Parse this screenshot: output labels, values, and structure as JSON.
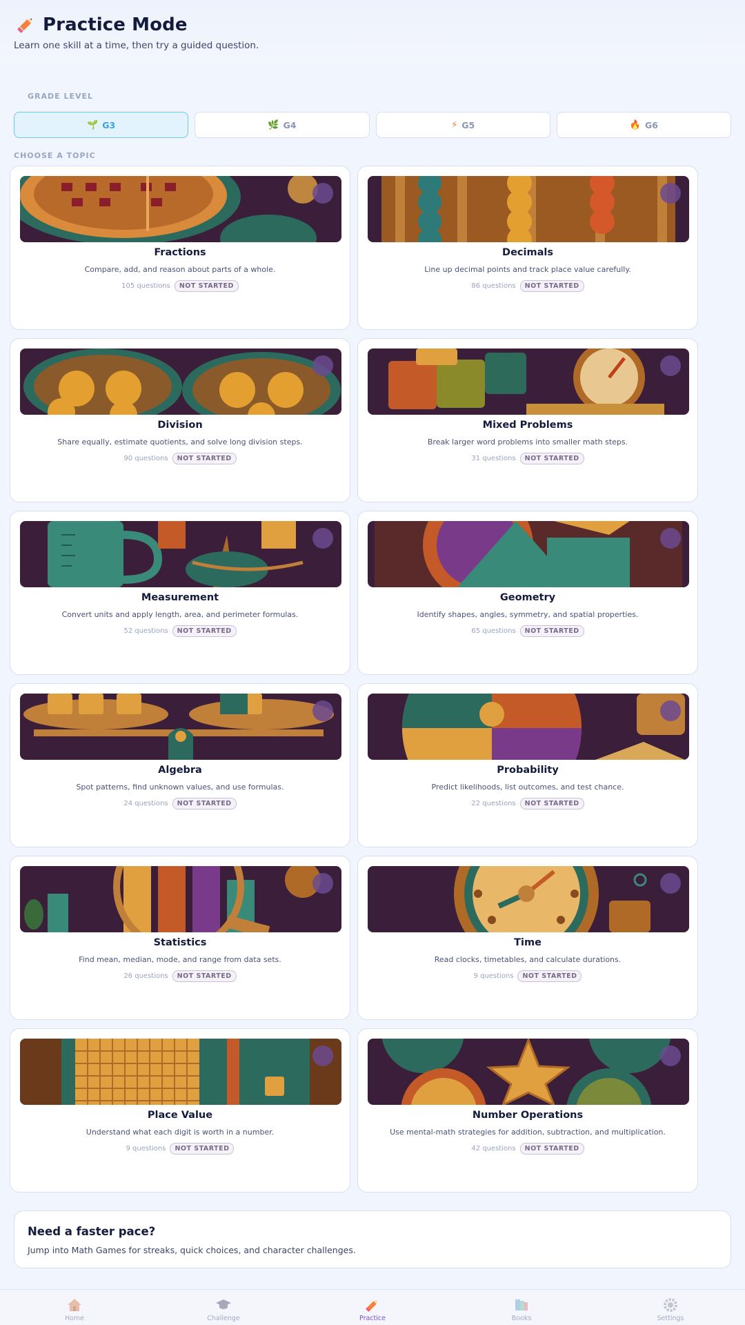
{
  "header": {
    "title": "Practice Mode",
    "subtitle": "Learn one skill at a time, then try a guided question."
  },
  "grade_section": {
    "label": "GRADE LEVEL",
    "grades": [
      {
        "label": "G3",
        "icon": "seedling-icon",
        "selected": true
      },
      {
        "label": "G4",
        "icon": "sprout-icon",
        "selected": false
      },
      {
        "label": "G5",
        "icon": "lightning-icon",
        "selected": false
      },
      {
        "label": "G6",
        "icon": "flame-icon",
        "selected": false
      }
    ]
  },
  "topic_section": {
    "label": "CHOOSE A TOPIC",
    "topics": [
      {
        "title": "Fractions",
        "desc": "Compare, add, and reason about parts of a whole.",
        "count": "105 questions",
        "status": "NOT STARTED",
        "art": "pie"
      },
      {
        "title": "Decimals",
        "desc": "Line up decimal points and track place value carefully.",
        "count": "86 questions",
        "status": "NOT STARTED",
        "art": "abacus"
      },
      {
        "title": "Division",
        "desc": "Share equally, estimate quotients, and solve long division steps.",
        "count": "90 questions",
        "status": "NOT STARTED",
        "art": "apples"
      },
      {
        "title": "Mixed Problems",
        "desc": "Break larger word problems into smaller math steps.",
        "count": "31 questions",
        "status": "NOT STARTED",
        "art": "blocks"
      },
      {
        "title": "Measurement",
        "desc": "Convert units and apply length, area, and perimeter formulas.",
        "count": "52 questions",
        "status": "NOT STARTED",
        "art": "measure"
      },
      {
        "title": "Geometry",
        "desc": "Identify shapes, angles, symmetry, and spatial properties.",
        "count": "65 questions",
        "status": "NOT STARTED",
        "art": "shapes"
      },
      {
        "title": "Algebra",
        "desc": "Spot patterns, find unknown values, and use formulas.",
        "count": "24 questions",
        "status": "NOT STARTED",
        "art": "balance"
      },
      {
        "title": "Probability",
        "desc": "Predict likelihoods, list outcomes, and test chance.",
        "count": "22 questions",
        "status": "NOT STARTED",
        "art": "spinner"
      },
      {
        "title": "Statistics",
        "desc": "Find mean, median, mode, and range from data sets.",
        "count": "26 questions",
        "status": "NOT STARTED",
        "art": "magnify"
      },
      {
        "title": "Time",
        "desc": "Read clocks, timetables, and calculate durations.",
        "count": "9 questions",
        "status": "NOT STARTED",
        "art": "clock"
      },
      {
        "title": "Place Value",
        "desc": "Understand what each digit is worth in a number.",
        "count": "9 questions",
        "status": "NOT STARTED",
        "art": "grid"
      },
      {
        "title": "Number Operations",
        "desc": "Use mental-math strategies for addition, subtraction, and multiplication.",
        "count": "42 questions",
        "status": "NOT STARTED",
        "art": "star"
      }
    ]
  },
  "promo": {
    "title": "Need a faster pace?",
    "text": "Jump into Math Games for streaks, quick choices, and character challenges."
  },
  "nav": {
    "items": [
      {
        "label": "Home",
        "icon": "house-icon",
        "active": false
      },
      {
        "label": "Challenge",
        "icon": "graduation-cap-icon",
        "active": false
      },
      {
        "label": "Practice",
        "icon": "pencil-icon",
        "active": true
      },
      {
        "label": "Books",
        "icon": "books-icon",
        "active": false
      },
      {
        "label": "Settings",
        "icon": "gear-icon",
        "active": false
      }
    ]
  }
}
